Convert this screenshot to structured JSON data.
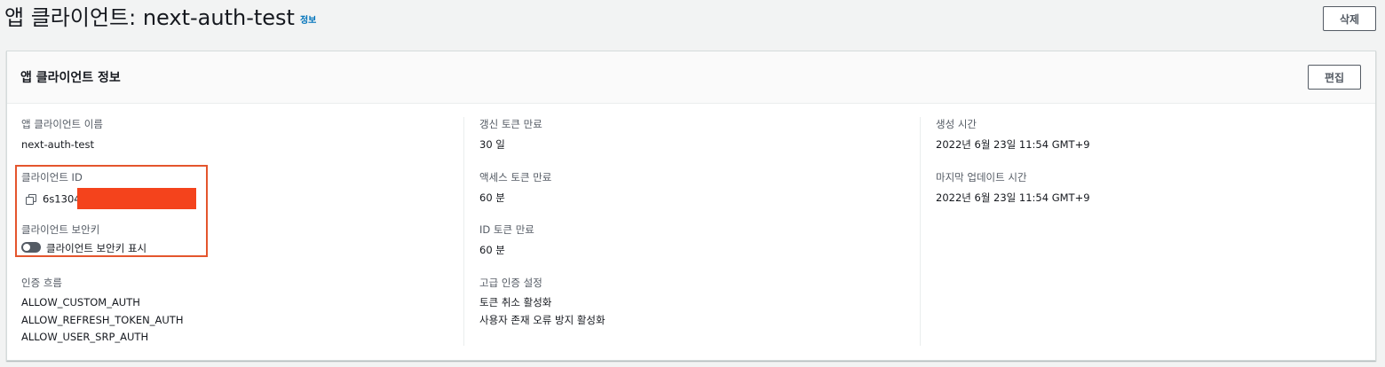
{
  "header": {
    "title": "앱 클라이언트: next-auth-test",
    "info_link": "정보",
    "delete_label": "삭제"
  },
  "panel": {
    "title": "앱 클라이언트 정보",
    "edit_label": "편집",
    "col1": {
      "client_name_label": "앱 클라이언트 이름",
      "client_name_value": "next-auth-test",
      "client_id_label": "클라이언트 ID",
      "client_id_value": "6s1304",
      "client_secret_label": "클라이언트 보안키",
      "client_secret_toggle_label": "클라이언트 보안키 표시",
      "auth_flow_label": "인증 흐름",
      "auth_flows": [
        "ALLOW_CUSTOM_AUTH",
        "ALLOW_REFRESH_TOKEN_AUTH",
        "ALLOW_USER_SRP_AUTH"
      ]
    },
    "col2": {
      "refresh_label": "갱신 토큰 만료",
      "refresh_value": "30 일",
      "access_label": "액세스 토큰 만료",
      "access_value": "60 분",
      "id_label": "ID 토큰 만료",
      "id_value": "60 분",
      "advanced_label": "고급 인증 설정",
      "advanced_values": [
        "토큰 취소 활성화",
        "사용자 존재 오류 방지 활성화"
      ]
    },
    "col3": {
      "created_label": "생성 시간",
      "created_value": "2022년 6월 23일 11:54 GMT+9",
      "updated_label": "마지막 업데이트 시간",
      "updated_value": "2022년 6월 23일 11:54 GMT+9"
    }
  },
  "colors": {
    "highlight": "#e4552d",
    "redaction": "#f4431c",
    "link": "#0073bb"
  }
}
